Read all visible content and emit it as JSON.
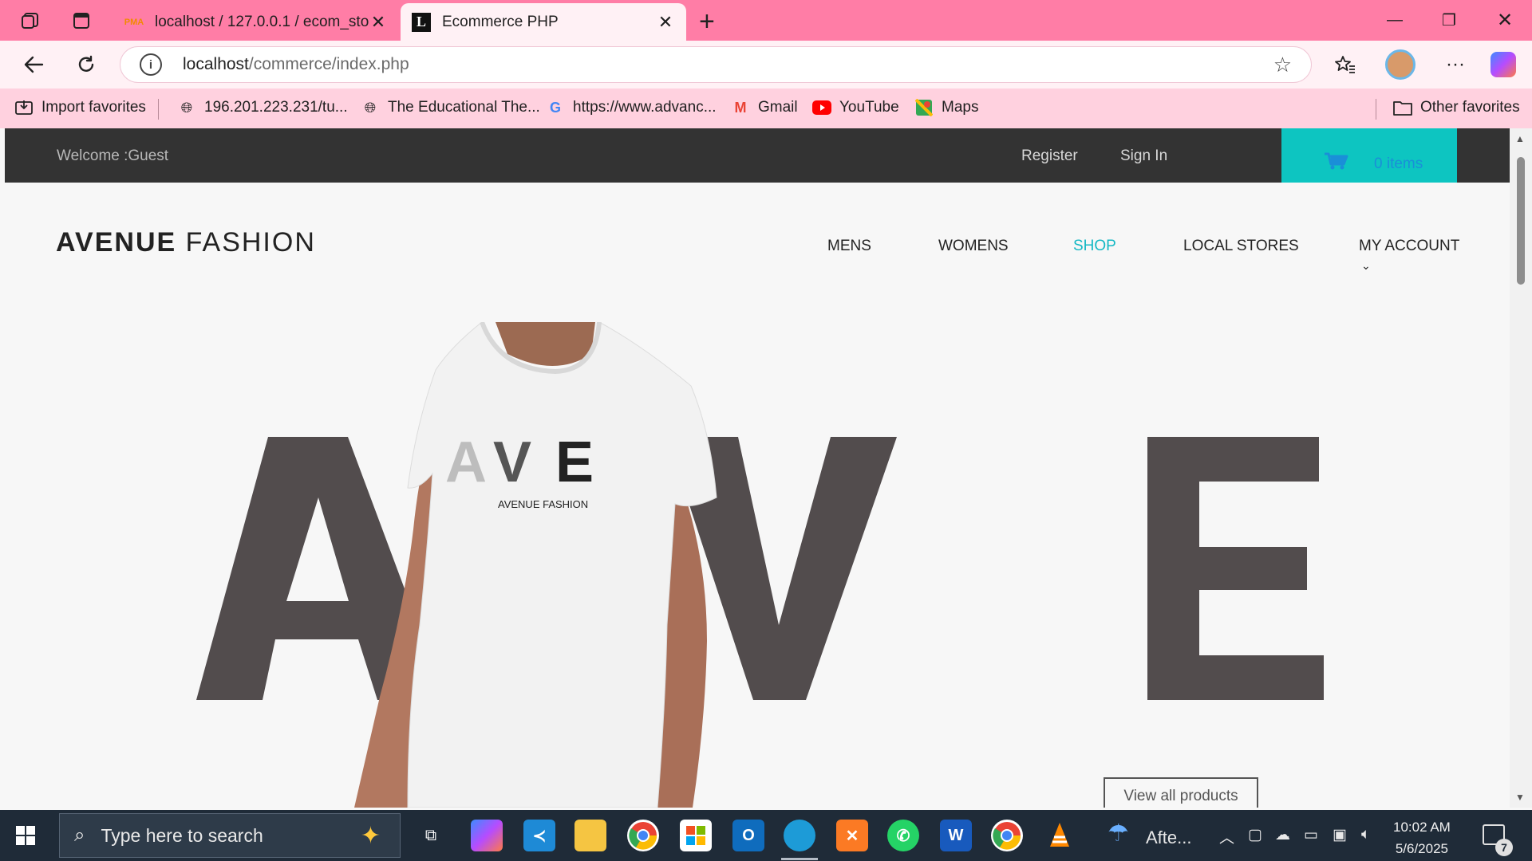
{
  "browser": {
    "tabs": [
      {
        "title": "localhost / 127.0.0.1 / ecom_store",
        "favicon": "pma-icon"
      },
      {
        "title": "Ecommerce PHP",
        "favicon": "L"
      }
    ],
    "address": {
      "host": "localhost",
      "path": "/commerce/index.php"
    },
    "bookmarks": [
      {
        "label": "Import favorites",
        "icon": "import-icon"
      },
      {
        "label": "196.201.223.231/tu...",
        "icon": "globe-icon"
      },
      {
        "label": "The Educational The...",
        "icon": "globe-icon"
      },
      {
        "label": "https://www.advanc...",
        "icon": "google-icon"
      },
      {
        "label": "Gmail",
        "icon": "gmail-icon"
      },
      {
        "label": "YouTube",
        "icon": "youtube-icon"
      },
      {
        "label": "Maps",
        "icon": "maps-icon"
      },
      {
        "label": "Other favorites",
        "icon": "folder-icon"
      }
    ]
  },
  "store": {
    "welcome": "Welcome :Guest",
    "register": "Register",
    "signin": "Sign In",
    "cart": "0 items",
    "logo_bold": "AVENUE",
    "logo_light": "FASHION",
    "menu": [
      "MENS",
      "WOMENS",
      "SHOP",
      "LOCAL STORES",
      "MY ACCOUNT"
    ],
    "hero_letters": [
      "A",
      "V",
      "E"
    ],
    "shirt_print_letters": "AVE",
    "shirt_print_text": "AVENUE FASHION",
    "view_all": "View all products"
  },
  "taskbar": {
    "search_placeholder": "Type here to search",
    "weather": "Afte...",
    "time": "10:02 AM",
    "date": "5/6/2025",
    "notifications": "7"
  },
  "colors": {
    "accent": "#0dc5c1",
    "active_menu": "#14b8c4",
    "hero_letters": "#524c4d",
    "browser_chrome": "#ff7da6"
  }
}
